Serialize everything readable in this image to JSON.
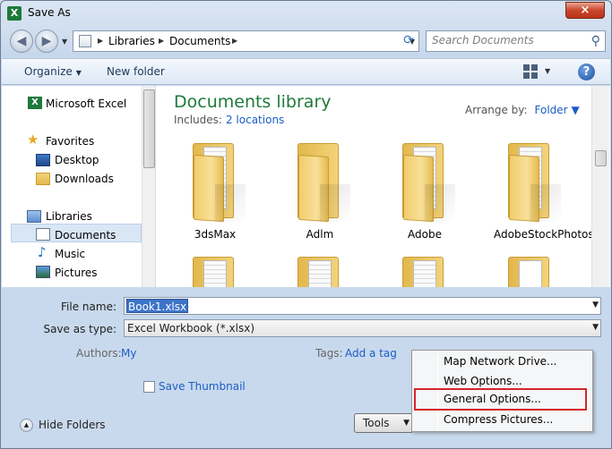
{
  "window": {
    "title": "Save As",
    "close_label": "×"
  },
  "nav": {
    "breadcrumb": [
      "Libraries",
      "Documents"
    ],
    "search_placeholder": "Search Documents"
  },
  "toolbar": {
    "organize": "Organize",
    "new_folder": "New folder",
    "help": "?"
  },
  "sidebar": {
    "items": [
      {
        "label": "Microsoft Excel",
        "icon": "excel-icon"
      },
      {
        "label": "Favorites",
        "icon": "star-icon"
      },
      {
        "label": "Desktop",
        "icon": "desktop-icon"
      },
      {
        "label": "Downloads",
        "icon": "downloads-icon"
      },
      {
        "label": "Libraries",
        "icon": "libraries-icon"
      },
      {
        "label": "Documents",
        "icon": "documents-icon",
        "selected": true
      },
      {
        "label": "Music",
        "icon": "music-icon"
      },
      {
        "label": "Pictures",
        "icon": "pictures-icon"
      }
    ]
  },
  "library": {
    "title": "Documents library",
    "includes_label": "Includes:",
    "includes_link": "2 locations",
    "arrange_label": "Arrange by:",
    "arrange_value": "Folder"
  },
  "folders": [
    {
      "name": "3dsMax"
    },
    {
      "name": "Adlm"
    },
    {
      "name": "Adobe"
    },
    {
      "name": "AdobeStockPhotos"
    }
  ],
  "form": {
    "file_name_label": "File name:",
    "file_name_value": "Book1.xlsx",
    "save_type_label": "Save as type:",
    "save_type_value": "Excel Workbook (*.xlsx)",
    "authors_label": "Authors:",
    "authors_value": "My",
    "tags_label": "Tags:",
    "tags_value": "Add a tag",
    "thumbnail_label": "Save Thumbnail",
    "hide_folders": "Hide Folders",
    "tools_label": "Tools"
  },
  "tools_menu": {
    "items": [
      {
        "label": "Map Network Drive..."
      },
      {
        "label": "Web Options..."
      },
      {
        "label": "General Options...",
        "highlighted": true
      },
      {
        "label": "Compress Pictures..."
      }
    ]
  },
  "colors": {
    "accent": "#1a5ec6",
    "library_title": "#1e7a3a",
    "highlight_box": "#d3262c",
    "selection": "#3d74c8"
  }
}
